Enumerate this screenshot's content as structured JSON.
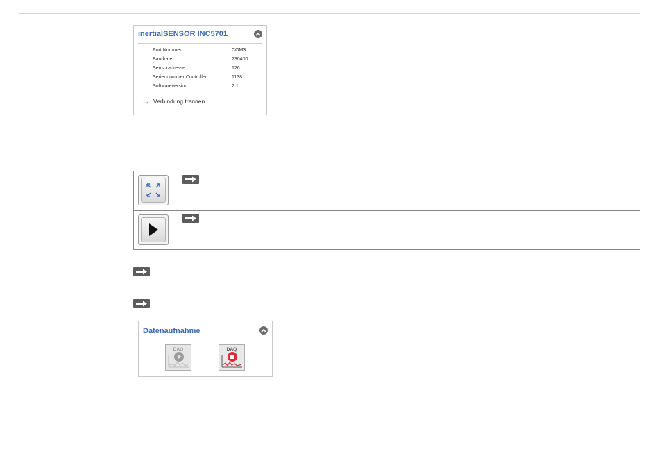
{
  "sensor_panel": {
    "title": "inertialSENSOR INC5701",
    "rows": [
      {
        "label": "Port Nummer:",
        "value": "COM3"
      },
      {
        "label": "Baudrate:",
        "value": "230400"
      },
      {
        "label": "Sensoradresse:",
        "value": "126"
      },
      {
        "label": "Seriennummer Controller:",
        "value": "1138"
      },
      {
        "label": "Softwareversion:",
        "value": "2.1"
      }
    ],
    "disconnect_label": "Verbindung trennen"
  },
  "daq_panel": {
    "title": "Datenaufnahme",
    "start_label": "DAQ",
    "stop_label": "DAQ"
  },
  "colors": {
    "accent_blue": "#3b6bb2",
    "arrow_badge": "#5c5c5c",
    "stop_red": "#e02a35"
  },
  "icons": {
    "fit_view": "fit-to-window-icon",
    "play": "play-icon",
    "collapse": "chevron-up-icon",
    "arrow": "right-arrow-icon"
  }
}
